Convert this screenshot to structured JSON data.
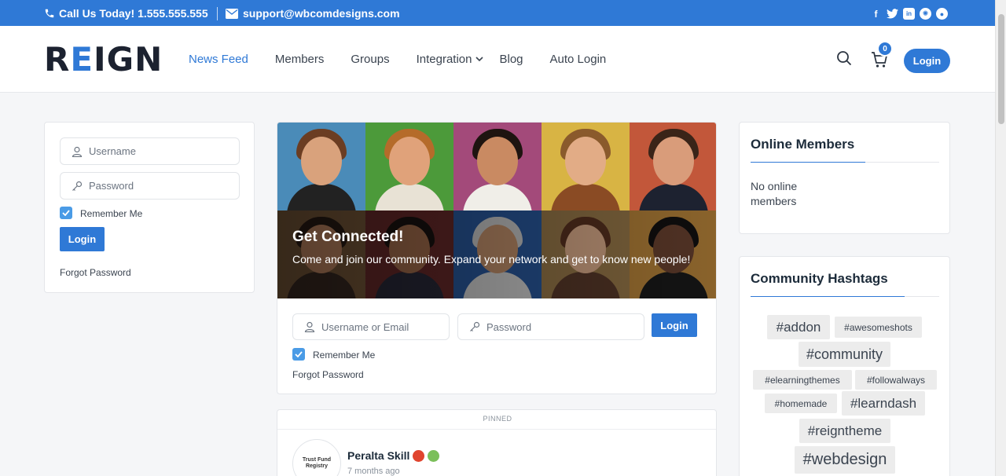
{
  "topbar": {
    "phone": "Call Us Today! 1.555.555.555",
    "email": "support@wbcomdesigns.com",
    "social_icons": [
      "facebook-icon",
      "twitter-icon",
      "linkedin-icon",
      "dribbble-icon",
      "github-icon"
    ]
  },
  "header": {
    "logo_left": "R",
    "logo_mid": "E",
    "logo_right": "IGN",
    "nav": [
      "News Feed",
      "Members",
      "Groups",
      "Integration",
      "Blog",
      "Auto Login"
    ],
    "cart_count": "0",
    "login_label": "Login"
  },
  "left_login": {
    "username_placeholder": "Username",
    "password_placeholder": "Password",
    "remember_label": "Remember Me",
    "remember_checked": true,
    "login_label": "Login",
    "forgot_label": "Forgot Password"
  },
  "hero": {
    "title": "Get Connected!",
    "text": "Come and join our community. Expand your network and get to know new people!"
  },
  "center_login": {
    "username_placeholder": "Username or Email",
    "password_placeholder": "Password",
    "login_label": "Login",
    "remember_label": "Remember Me",
    "remember_checked": true,
    "forgot_label": "Forgot Password"
  },
  "pinned_post": {
    "label": "PINNED",
    "avatar_text": "Trust Fund Registry",
    "author": "Peralta Skill",
    "time": "7 months ago"
  },
  "online_members": {
    "title": "Online Members",
    "text": "No online members"
  },
  "hashtags": {
    "title": "Community Hashtags",
    "tags": [
      "#addon",
      "#awesomeshots",
      "#community",
      "#elearningthemes",
      "#followalways",
      "#homemade",
      "#learndash",
      "#reigntheme",
      "#webdesign"
    ]
  },
  "colors": {
    "accent": "#2f79d6",
    "topbar": "#2f79d6",
    "page_bg": "#f5f6f8",
    "text_dark": "#1c2b3a"
  }
}
